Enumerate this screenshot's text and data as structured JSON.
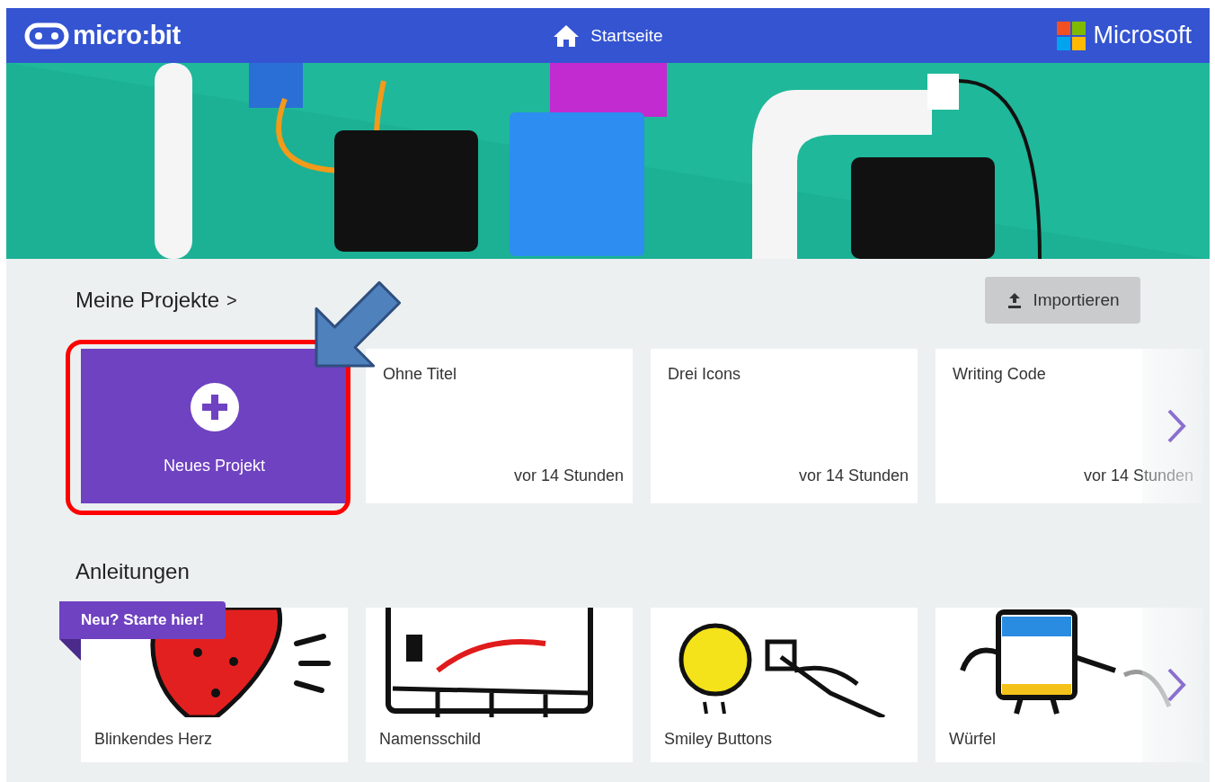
{
  "header": {
    "logo": "micro:bit",
    "nav": "Startseite",
    "brand": "Microsoft"
  },
  "my_projects": {
    "title": "Meine Projekte",
    "chevron": ">",
    "import_button": "Importieren",
    "new_project": "Neues Projekt",
    "projects": [
      {
        "name": "Ohne Titel",
        "time": "vor 14 Stunden"
      },
      {
        "name": "Drei Icons",
        "time": "vor 14 Stunden"
      },
      {
        "name": "Writing Code",
        "time": "vor 14 Stunden"
      }
    ]
  },
  "tutorials": {
    "title": "Anleitungen",
    "badge": "Neu? Starte hier!",
    "items": [
      {
        "name": "Blinkendes Herz"
      },
      {
        "name": "Namensschild"
      },
      {
        "name": "Smiley Buttons"
      },
      {
        "name": "Würfel"
      }
    ]
  }
}
